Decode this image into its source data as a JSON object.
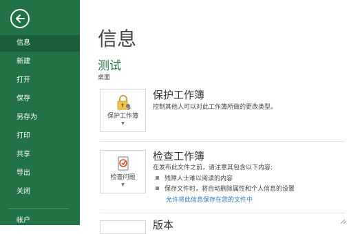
{
  "sidebar": {
    "back_icon": "back-arrow-icon",
    "items": [
      {
        "label": "信息",
        "active": true
      },
      {
        "label": "新建"
      },
      {
        "label": "打开"
      },
      {
        "label": "保存"
      },
      {
        "label": "另存为"
      },
      {
        "label": "打印"
      },
      {
        "label": "共享"
      },
      {
        "label": "导出"
      },
      {
        "label": "关闭"
      },
      {
        "label": "帐户"
      }
    ],
    "accent_color": "#217346"
  },
  "main": {
    "title": "信息",
    "doc_name": "测试",
    "doc_path": "桌面",
    "sections": [
      {
        "button_label": "保护工作簿",
        "button_icon": "lock-key-icon",
        "title": "保护工作簿",
        "description": "控制其他人可以对此工作簿所做的更改类型。"
      },
      {
        "button_label": "检查问题",
        "button_icon": "inspect-document-icon",
        "title": "检查工作簿",
        "description": "在发布此文件之前，请注意其包含以下内容:",
        "bullets": [
          "残障人士难以阅读的内容",
          "保存文件时，将自动删除属性和个人信息的设置"
        ],
        "link": "允许将此信息保存在您的文件中"
      },
      {
        "title": "版本"
      }
    ]
  }
}
